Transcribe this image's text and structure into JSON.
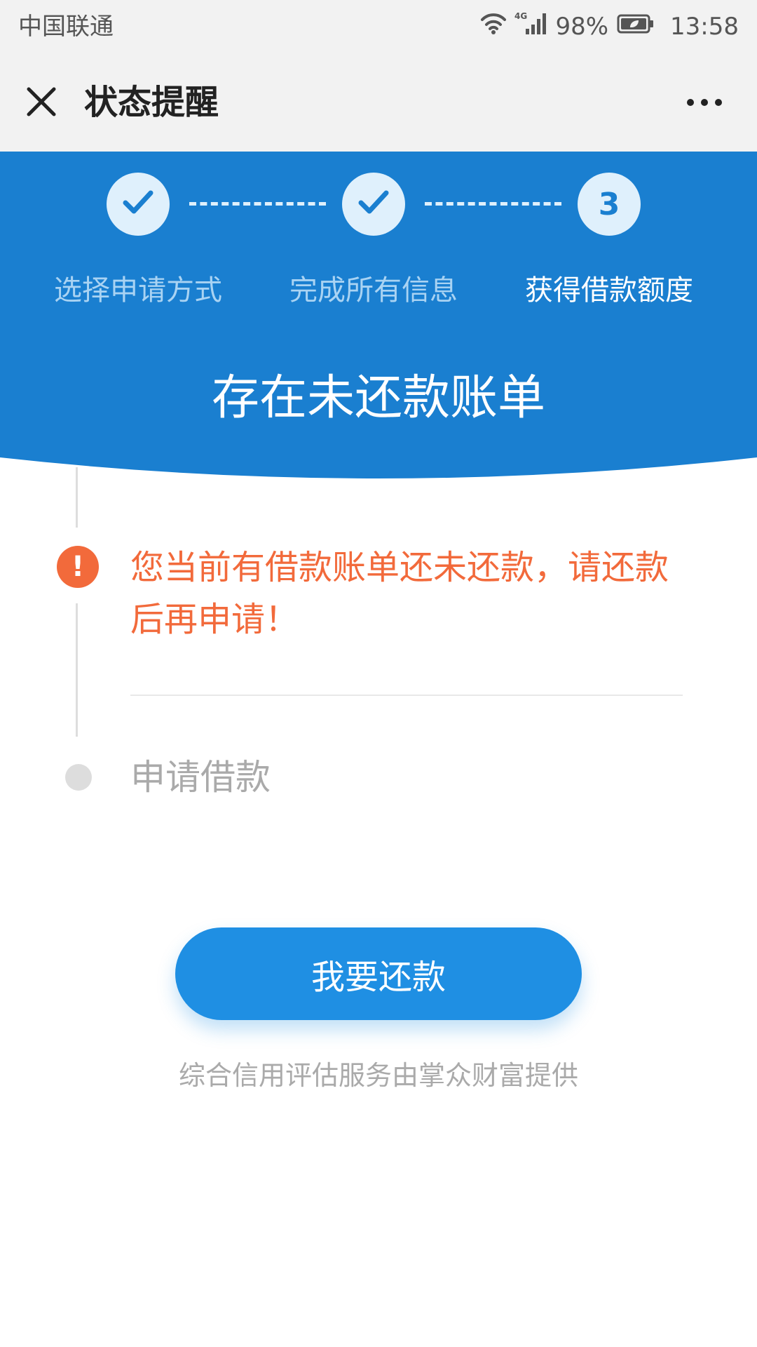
{
  "status_bar": {
    "carrier": "中国联通",
    "network": "4G",
    "battery": "98%",
    "time": "13:58"
  },
  "nav": {
    "title": "状态提醒"
  },
  "steps": [
    {
      "label": "选择申请方式",
      "state": "done"
    },
    {
      "label": "完成所有信息",
      "state": "done"
    },
    {
      "label": "获得借款额度",
      "state": "current",
      "number": "3"
    }
  ],
  "header": {
    "title": "存在未还款账单"
  },
  "timeline": {
    "alert": "您当前有借款账单还未还款，请还款后再申请！",
    "alert_icon": "!",
    "next_step": "申请借款"
  },
  "action": {
    "button_label": "我要还款"
  },
  "footer": {
    "note": "综合信用评估服务由掌众财富提供"
  },
  "colors": {
    "header_blue": "#1a7fd0",
    "button_blue": "#1f8fe3",
    "alert_orange": "#f26a3b",
    "step_circle": "#dff0fc"
  }
}
